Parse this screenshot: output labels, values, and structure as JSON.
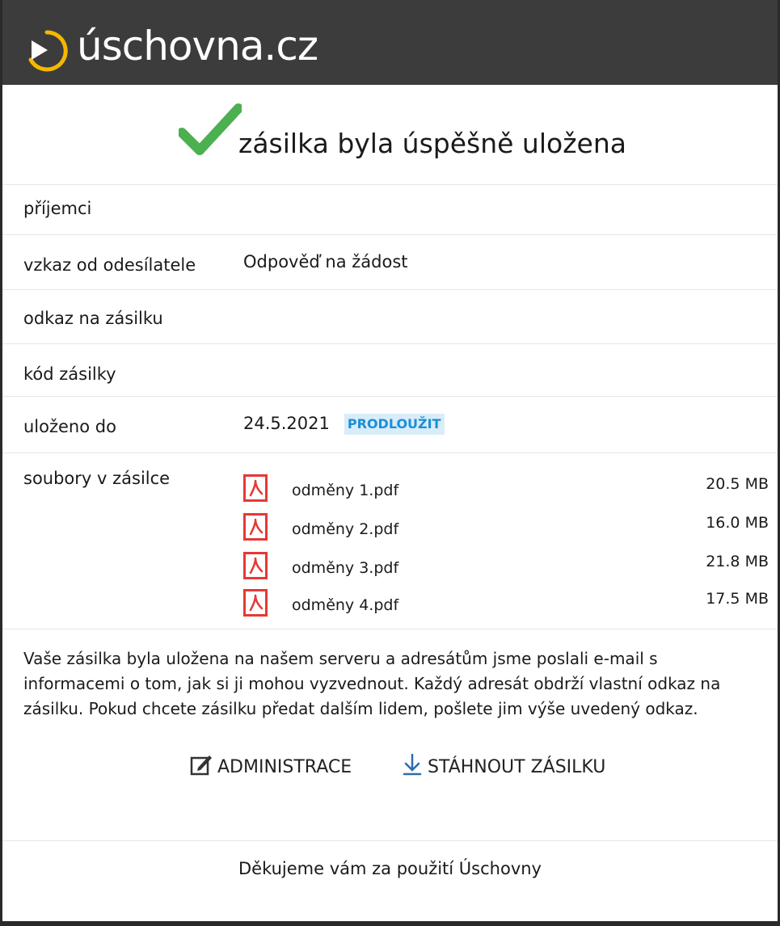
{
  "header": {
    "logo_text": "úschovna.cz",
    "logo_icon": "play-circle-icon"
  },
  "success": {
    "title": "zásilka byla úspěšně uložena",
    "icon": "checkmark-icon",
    "accent": "#4caf50"
  },
  "fields": {
    "recipients_label": "příjemci",
    "recipients_value": "",
    "message_label": "vzkaz od odesílatele",
    "message_value": "Odpověď na žádost",
    "link_label": "odkaz na zásilku",
    "link_value": "",
    "code_label": "kód zásilky",
    "code_value": "",
    "stored_label": "uloženo do",
    "stored_value": "24.5.2021",
    "extend_label": "PRODLOUŽIT",
    "files_label": "soubory v zásilce"
  },
  "files": [
    {
      "name": "odměny 1.pdf",
      "size": "20.5 MB",
      "icon": "pdf-icon"
    },
    {
      "name": "odměny 2.pdf",
      "size": "16.0 MB",
      "icon": "pdf-icon"
    },
    {
      "name": "odměny 3.pdf",
      "size": "21.8 MB",
      "icon": "pdf-icon"
    },
    {
      "name": "odměny 4.pdf",
      "size": "17.5 MB",
      "icon": "pdf-icon"
    }
  ],
  "note": "Vaše zásilka byla uložena na našem serveru a adresátům jsme poslali e-mail s informacemi o tom, jak si ji mohou vyzvednout. Každý adresát obdrží vlastní odkaz na zásilku. Pokud chcete zásilku předat dalším lidem, pošlete jim výše uvedený odkaz.",
  "actions": {
    "admin_label": "ADMINISTRACE",
    "admin_icon": "edit-icon",
    "download_label": "STÁHNOUT ZÁSILKU",
    "download_icon": "download-icon"
  },
  "footer": {
    "thanks": "Děkujeme vám za použití Úschovny"
  },
  "colors": {
    "header_bg": "#3c3c3c",
    "logo_ring": "#f5b800",
    "extend_text": "#1b8fd6",
    "pdf_red": "#e53935"
  }
}
